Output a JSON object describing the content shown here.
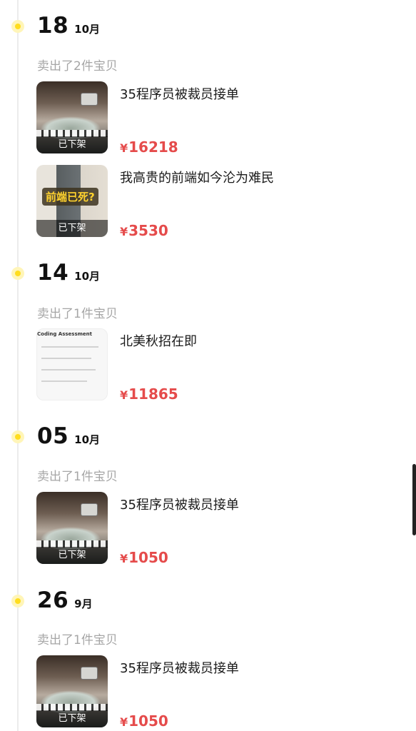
{
  "groups": [
    {
      "day": "18",
      "month": "10月",
      "sold": "卖出了2件宝贝",
      "items": [
        {
          "title": "35程序员被裁员接单",
          "price": "16218",
          "currency": "¥",
          "badge": "已下架",
          "thumb": "photo"
        },
        {
          "title": "我高贵的前端如今沦为难民",
          "price": "3530",
          "currency": "¥",
          "badge": "已下架",
          "thumb": "window",
          "thumb_caption": "前端已死?"
        }
      ]
    },
    {
      "day": "14",
      "month": "10月",
      "sold": "卖出了1件宝贝",
      "items": [
        {
          "title": "北美秋招在即",
          "price": "11865",
          "currency": "¥",
          "thumb": "doc",
          "thumb_caption": "Coding Assessment"
        }
      ]
    },
    {
      "day": "05",
      "month": "10月",
      "sold": "卖出了1件宝贝",
      "items": [
        {
          "title": "35程序员被裁员接单",
          "price": "1050",
          "currency": "¥",
          "badge": "已下架",
          "thumb": "photo"
        }
      ]
    },
    {
      "day": "26",
      "month": "9月",
      "sold": "卖出了1件宝贝",
      "items": [
        {
          "title": "35程序员被裁员接单",
          "price": "1050",
          "currency": "¥",
          "badge": "已下架",
          "thumb": "photo"
        }
      ]
    }
  ],
  "colors": {
    "accent_dot": "#ffdd1f",
    "price": "#e54b4b",
    "muted_text": "#a6a6a6"
  }
}
